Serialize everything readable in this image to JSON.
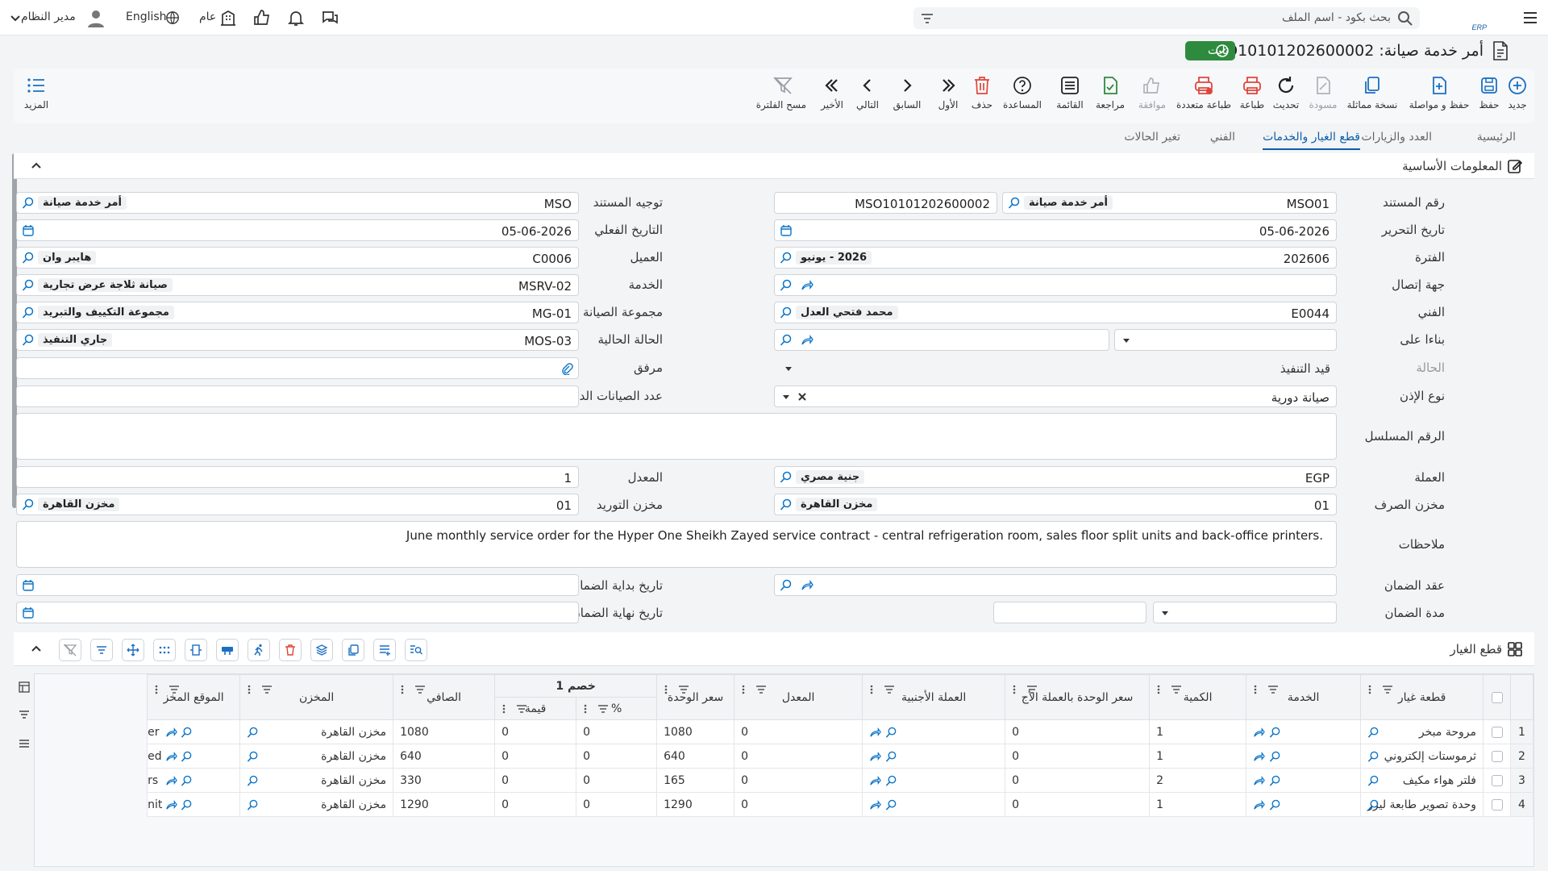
{
  "topbar": {
    "search_placeholder": "بحث بكود - اسم الملف",
    "language": "English",
    "scope": "عام",
    "user": "مدير النظام"
  },
  "page": {
    "title": "أمر خدمة صيانة: MSO10101202600002",
    "status": "ثابت"
  },
  "toolbar": [
    {
      "label": "جديد",
      "icon": "plus-circle-icon"
    },
    {
      "label": "حفظ",
      "icon": "save-icon"
    },
    {
      "label": "حفظ و مواصلة",
      "icon": "save-continue-icon"
    },
    {
      "label": "نسخة مماثلة",
      "icon": "copy-icon"
    },
    {
      "label": "مسودة",
      "icon": "draft-icon"
    },
    {
      "label": "تحديث",
      "icon": "refresh-icon"
    },
    {
      "label": "طباعة",
      "icon": "print-icon"
    },
    {
      "label": "طباعة متعددة",
      "icon": "multi-print-icon"
    },
    {
      "label": "موافقة",
      "icon": "thumbs-up-icon"
    },
    {
      "label": "مراجعة",
      "icon": "review-icon"
    },
    {
      "label": "القائمة",
      "icon": "list-icon"
    },
    {
      "label": "المساعدة",
      "icon": "help-icon"
    },
    {
      "label": "حذف",
      "icon": "trash-icon"
    },
    {
      "label": "الأول",
      "icon": "first-icon"
    },
    {
      "label": "السابق",
      "icon": "previous-icon"
    },
    {
      "label": "التالي",
      "icon": "next-icon"
    },
    {
      "label": "الأخير",
      "icon": "last-icon"
    },
    {
      "label": "مسح الفلترة",
      "icon": "clear-filter-icon"
    },
    {
      "label": "المزيد",
      "icon": "more-icon"
    }
  ],
  "tabs": [
    "الرئيسية",
    "العدد والزيارات",
    "قطع الغيار والخدمات",
    "الفني",
    "تغير الحالات"
  ],
  "basic_info": {
    "section_title": "المعلومات الأساسية",
    "doc_number": {
      "label": "رقم المستند",
      "code": "MSO01",
      "desc": "أمر خدمة صيانة",
      "value2": "MSO10101202600002"
    },
    "doc_direction": {
      "label": "توجيه المستند",
      "code": "MSO",
      "desc": "أمر خدمة صيانة"
    },
    "edit_date": {
      "label": "تاريخ التحرير",
      "value": "05-06-2026"
    },
    "actual_date": {
      "label": "التاريخ الفعلي",
      "value": "05-06-2026"
    },
    "period": {
      "label": "الفترة",
      "code": "202606",
      "desc": "2026 - يونيو"
    },
    "customer": {
      "label": "العميل",
      "code": "C0006",
      "desc": "هايبر وان"
    },
    "contact": {
      "label": "جهة إتصال"
    },
    "service": {
      "label": "الخدمة",
      "code": "MSRV-02",
      "desc": "صيانة ثلاجة عرض تجارية"
    },
    "technician": {
      "label": "الفني",
      "code": "E0044",
      "desc": "محمد فتحي العدل"
    },
    "maint_group": {
      "label": "مجموعة الصيانة",
      "code": "MG-01",
      "desc": "مجموعة التكييف والتبريد"
    },
    "based_on": {
      "label": "بناءا على"
    },
    "current_state": {
      "label": "الحالة الحالية",
      "code": "MOS-03",
      "desc": "جاري التنفيذ"
    },
    "state": {
      "label": "الحالة",
      "value": "قيد التنفيذ"
    },
    "attachment": {
      "label": "مرفق"
    },
    "permit_type": {
      "label": "نوع الإذن",
      "value": "صيانة دورية"
    },
    "periodic_count": {
      "label": "عدد الصيانات الدورية"
    },
    "serial_no": {
      "label": "الرقم المسلسل"
    },
    "currency": {
      "label": "العملة",
      "code": "EGP",
      "desc": "جنية مصري"
    },
    "rate": {
      "label": "المعدل",
      "value": "1"
    },
    "issue_store": {
      "label": "مخزن الصرف",
      "code": "01",
      "desc": "مخزن القاهرة"
    },
    "supply_store": {
      "label": "مخزن التوريد",
      "code": "01",
      "desc": "مخزن القاهرة"
    },
    "notes": {
      "label": "ملاحظات",
      "value": "June monthly service order for the Hyper One Sheikh Zayed service contract - central refrigeration room, sales floor split units and back-office printers."
    },
    "warranty_contract": {
      "label": "عقد الضمان"
    },
    "warranty_start": {
      "label": "تاريخ بداية الضمان"
    },
    "warranty_period": {
      "label": "مدة الضمان"
    },
    "warranty_end": {
      "label": "تاريخ نهاية الضمان"
    }
  },
  "parts": {
    "section_title": "قطع الغيار",
    "headers": {
      "part": "قطعة غيار",
      "service": "الخدمة",
      "qty": "الكمية",
      "fc_price": "سعر الوحدة بالعملة الأج",
      "fc": "العملة الأجنبية",
      "rate": "المعدل",
      "unit_price": "سعر الوحدة",
      "discount_group": "خصم 1",
      "discount_pct": "%",
      "discount_val": "قيمة",
      "net": "الصافي",
      "store": "المخزن",
      "location": "الموقع المخز"
    },
    "rows": [
      {
        "n": "1",
        "part": "مروحة مبخر",
        "qty": "1",
        "fc_price": "0",
        "rate": "0",
        "unit_price": "1080",
        "pct": "0",
        "val": "0",
        "net": "1080",
        "store": "مخزن القاهرة",
        "loc": "er"
      },
      {
        "n": "2",
        "part": "ثرموستات إلكتروني",
        "qty": "1",
        "fc_price": "0",
        "rate": "0",
        "unit_price": "640",
        "pct": "0",
        "val": "0",
        "net": "640",
        "store": "مخزن القاهرة",
        "loc": "ed"
      },
      {
        "n": "3",
        "part": "فلتر هواء مكيف",
        "qty": "2",
        "fc_price": "0",
        "rate": "0",
        "unit_price": "165",
        "pct": "0",
        "val": "0",
        "net": "330",
        "store": "مخزن القاهرة",
        "loc": "rs"
      },
      {
        "n": "4",
        "part": "وحدة تصوير طابعة ليزر",
        "qty": "1",
        "fc_price": "0",
        "rate": "0",
        "unit_price": "1290",
        "pct": "0",
        "val": "0",
        "net": "1290",
        "store": "مخزن القاهرة",
        "loc": "nit"
      }
    ]
  }
}
